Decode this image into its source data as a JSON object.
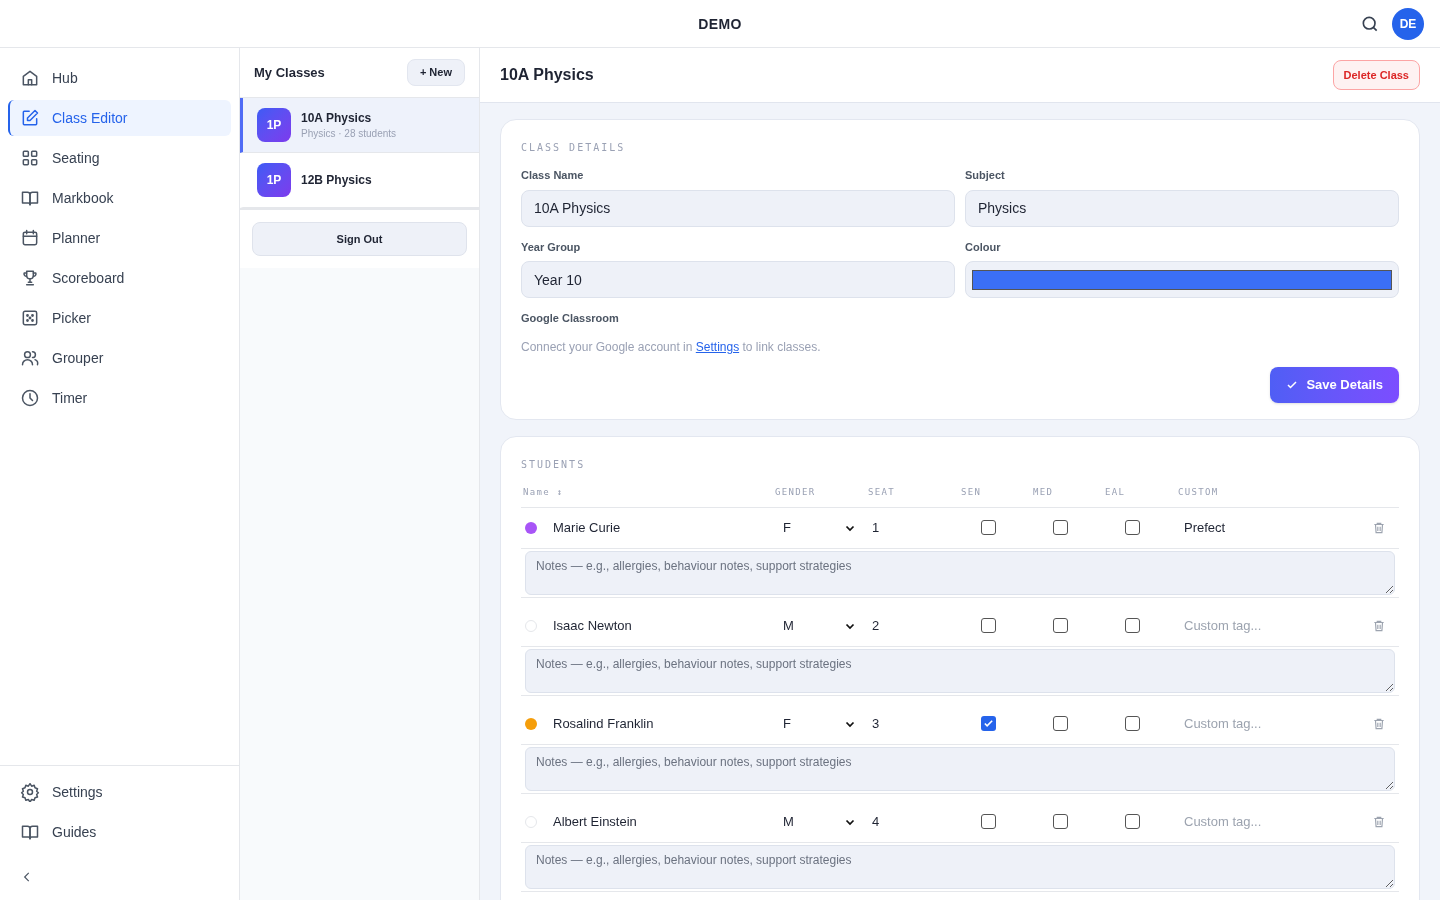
{
  "topbar": {
    "title": "DEMO",
    "avatar": "DE"
  },
  "sidebar": {
    "items": [
      {
        "label": "Hub",
        "kind": "home",
        "selected": false
      },
      {
        "label": "Class Editor",
        "kind": "edit",
        "selected": true
      },
      {
        "label": "Seating",
        "kind": "grid",
        "selected": false
      },
      {
        "label": "Markbook",
        "kind": "book",
        "selected": false
      },
      {
        "label": "Planner",
        "kind": "calendar",
        "selected": false
      },
      {
        "label": "Scoreboard",
        "kind": "trophy",
        "selected": false
      },
      {
        "label": "Picker",
        "kind": "dice",
        "selected": false
      },
      {
        "label": "Grouper",
        "kind": "users",
        "selected": false
      },
      {
        "label": "Timer",
        "kind": "clock",
        "selected": false
      }
    ],
    "footer_items": [
      {
        "label": "Settings",
        "kind": "gear"
      },
      {
        "label": "Guides",
        "kind": "book"
      }
    ]
  },
  "classes": {
    "title": "My Classes",
    "new_button": "+ New",
    "items": [
      {
        "badge": "1P",
        "name": "10A Physics",
        "subtitle": "Physics · 28 students",
        "selected": true
      },
      {
        "badge": "1P",
        "name": "12B Physics",
        "selected": false
      }
    ],
    "sign_out": "Sign Out"
  },
  "editor": {
    "title": "10A Physics",
    "delete_button": "Delete Class",
    "details": {
      "heading": "CLASS DETAILS",
      "fields": [
        {
          "label": "Class Name",
          "value": "10A Physics",
          "kind": "text"
        },
        {
          "label": "Subject",
          "value": "Physics",
          "kind": "text"
        },
        {
          "label": "Year Group",
          "value": "Year 10",
          "kind": "text"
        },
        {
          "label": "Colour",
          "color": "#3b6ff5",
          "kind": "color"
        }
      ],
      "google_label": "Google Classroom",
      "google_text_before": "Connect your Google account in",
      "google_link": "Settings",
      "google_text_after": "to link classes.",
      "save_button": "Save Details"
    },
    "students": {
      "heading": "STUDENTS",
      "columns": [
        "Name ↕",
        "GENDER",
        "SEAT",
        "SEN",
        "MED",
        "EAL",
        "CUSTOM"
      ],
      "rows": [
        {
          "color": "#a855f7",
          "name": "Marie Curie",
          "gender": "F",
          "seat": "1",
          "sen": false,
          "med": false,
          "eal": false,
          "custom": "Prefect",
          "notes_placeholder": "Notes — e.g., allergies, behaviour notes, support strategies"
        },
        {
          "name": "Isaac Newton",
          "gender": "M",
          "seat": "2",
          "sen": false,
          "med": false,
          "eal": false,
          "custom_placeholder": "Custom tag...",
          "notes_placeholder": "Notes — e.g., allergies, behaviour notes, support strategies"
        },
        {
          "color": "#f59e0b",
          "name": "Rosalind Franklin",
          "gender": "F",
          "seat": "3",
          "sen": true,
          "med": false,
          "eal": false,
          "custom_placeholder": "Custom tag...",
          "notes_placeholder": "Notes — e.g., allergies, behaviour notes, support strategies"
        },
        {
          "name": "Albert Einstein",
          "gender": "M",
          "seat": "4",
          "sen": false,
          "med": false,
          "eal": false,
          "custom_placeholder": "Custom tag...",
          "notes_placeholder": "Notes — e.g., allergies, behaviour notes, support strategies"
        }
      ]
    }
  }
}
